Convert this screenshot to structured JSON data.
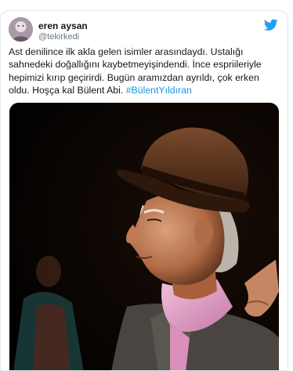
{
  "tweet": {
    "author": {
      "display_name": "eren aysan",
      "handle": "@tekirkedi",
      "avatar_icon": "user-avatar"
    },
    "brand_icon": "twitter-bird-icon",
    "brand_color": "#1da1f2",
    "text": "Ast denilince ilk akla gelen isimler arasındaydı. Ustalığı sahnedeki doğallığını kaybetmeyişindendi. İnce espriileriyle hepimizi kırıp geçirirdi. Bugün aramızdan ayrıldı, çok erken oldu. Hoşça kal Bülent Abi.",
    "hashtag": "#BülentYıldıran",
    "hashtag_color": "#1b95e0",
    "media": {
      "type": "photo",
      "description_icon": "stage-portrait-photo"
    }
  }
}
